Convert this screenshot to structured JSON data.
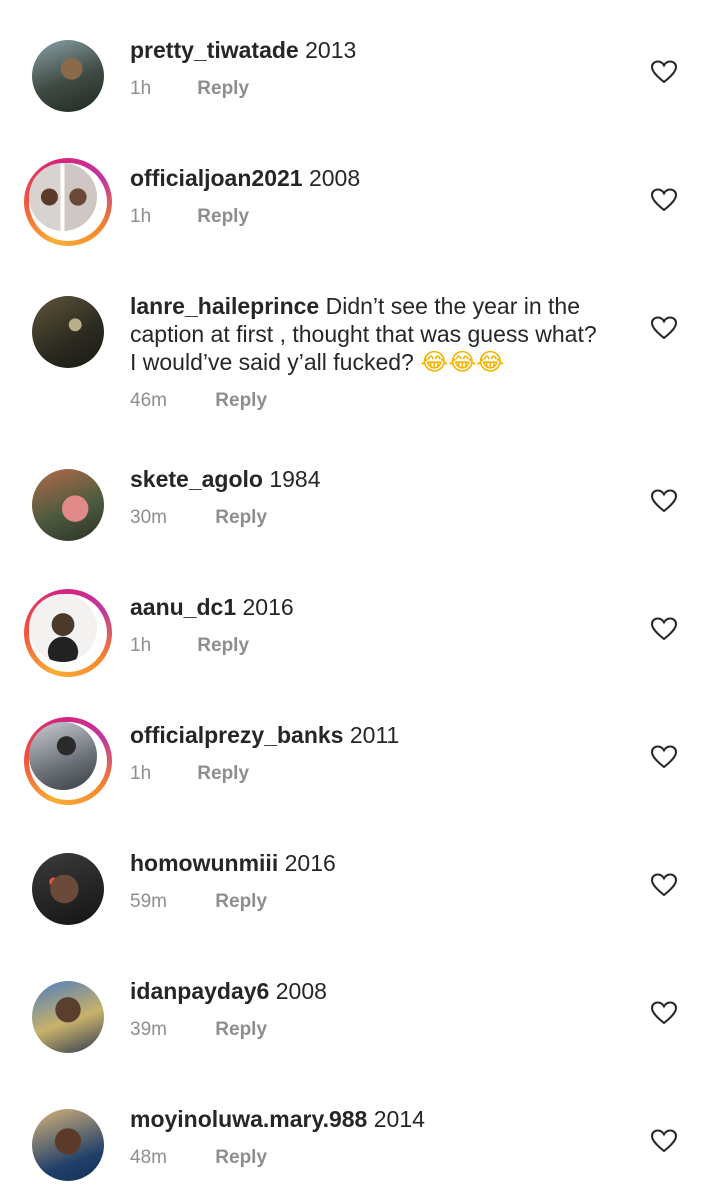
{
  "reply_label": "Reply",
  "colors": {
    "username_text": "#262626",
    "meta_text": "#8e8e8e",
    "story_ring_start": "#f9b036",
    "story_ring_end": "#d8237b",
    "heart_stroke": "#262626"
  },
  "comments": [
    {
      "username": "pretty_tiwatade",
      "text": "2013",
      "time": "1h",
      "story_ring": false,
      "avatar_icon": "user-avatar",
      "like_icon": "heart-outline-icon"
    },
    {
      "username": "officialjoan2021",
      "text": "2008",
      "time": "1h",
      "story_ring": true,
      "avatar_icon": "user-avatar",
      "like_icon": "heart-outline-icon"
    },
    {
      "username": "lanre_haileprince",
      "text": "Didn’t see the year in the",
      "text_line2": "caption at first , thought that was guess what?",
      "text_line3": "I would’ve said y’all fucked?",
      "emojis": "😂😂😂",
      "time": "46m",
      "story_ring": false,
      "avatar_icon": "user-avatar",
      "like_icon": "heart-outline-icon"
    },
    {
      "username": "skete_agolo",
      "text": "1984",
      "time": "30m",
      "story_ring": false,
      "avatar_icon": "user-avatar",
      "like_icon": "heart-outline-icon"
    },
    {
      "username": "aanu_dc1",
      "text": "2016",
      "time": "1h",
      "story_ring": true,
      "avatar_icon": "user-avatar",
      "like_icon": "heart-outline-icon"
    },
    {
      "username": "officialprezy_banks",
      "text": "2011",
      "time": "1h",
      "story_ring": true,
      "avatar_icon": "user-avatar",
      "like_icon": "heart-outline-icon"
    },
    {
      "username": "homowunmiii",
      "text": "2016",
      "time": "59m",
      "story_ring": false,
      "avatar_icon": "user-avatar",
      "like_icon": "heart-outline-icon"
    },
    {
      "username": "idanpayday6",
      "text": "2008",
      "time": "39m",
      "story_ring": false,
      "avatar_icon": "user-avatar",
      "like_icon": "heart-outline-icon"
    },
    {
      "username": "moyinoluwa.mary.988",
      "text": "2014",
      "time": "48m",
      "story_ring": false,
      "avatar_icon": "user-avatar",
      "like_icon": "heart-outline-icon"
    }
  ]
}
